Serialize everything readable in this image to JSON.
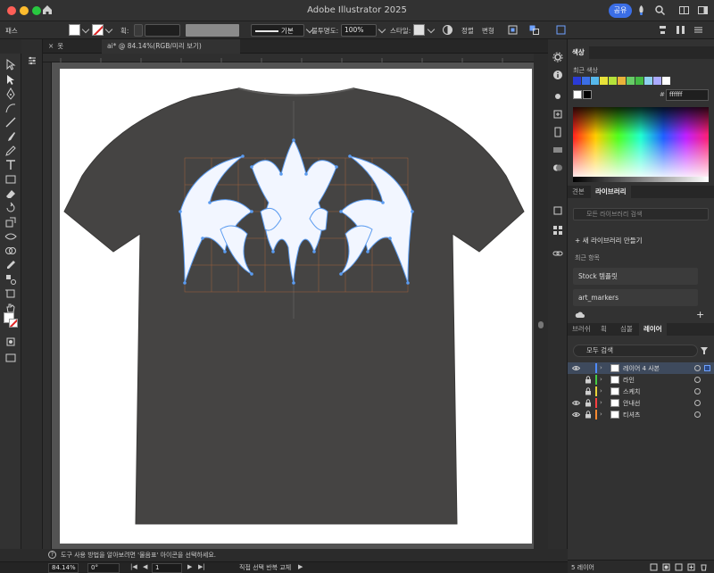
{
  "window": {
    "title": "Adobe Illustrator 2025",
    "share_label": "공유"
  },
  "control_bar": {
    "path_label": "패스",
    "stroke_label": "획:",
    "stroke_style": "기본",
    "opacity_label": "불투명도:",
    "opacity_value": "100%",
    "style_label": "스타일:",
    "align_label": "정렬",
    "transform_label": "변형"
  },
  "document_tabs": [
    {
      "label": "옷"
    },
    {
      "label": "ai* @ 84.14%(RGB/미리 보기)"
    }
  ],
  "color_panel": {
    "title": "색상",
    "recent_label": "최근 색상",
    "recent_swatches": [
      "#2a3bd6",
      "#3b6ee6",
      "#56b7ea",
      "#e8e23a",
      "#b4e23a",
      "#eab23a",
      "#66cc66",
      "#44bb44",
      "#8fd0f0",
      "#aaaaff",
      "#ffffff"
    ],
    "hex_value": "ffffff"
  },
  "library_panel": {
    "tabs": [
      "견본",
      "라이브러리"
    ],
    "search_placeholder": "모든 라이브러리 검색",
    "new_library": "새 라이브러리 만들기",
    "recent_items_label": "최근 항목",
    "items": [
      "Stock 템플릿",
      "art_markers"
    ]
  },
  "layers_panel": {
    "tabs": [
      "브러쉬",
      "획",
      "심볼",
      "레이어"
    ],
    "search_placeholder": "모두 검색",
    "layers": [
      {
        "name": "레이어 4 사본",
        "visible": true,
        "locked": false,
        "color": "#4f8bff",
        "selected": true
      },
      {
        "name": "라인",
        "visible": false,
        "locked": true,
        "color": "#44cc44",
        "selected": false
      },
      {
        "name": "스케치",
        "visible": false,
        "locked": true,
        "color": "#e8d43a",
        "selected": false
      },
      {
        "name": "안내선",
        "visible": true,
        "locked": true,
        "color": "#ff4040",
        "selected": false
      },
      {
        "name": "티셔츠",
        "visible": true,
        "locked": true,
        "color": "#ff8a30",
        "selected": false
      }
    ],
    "footer_label": "5 레이어"
  },
  "status": {
    "message": "도구 사용 방법을 알아보려면 '물음표' 아이콘을 선택하세요.",
    "zoom": "84.14%",
    "rotation": "0°",
    "artboard_number": "1",
    "mode": "직접 선택 반복 교체"
  }
}
